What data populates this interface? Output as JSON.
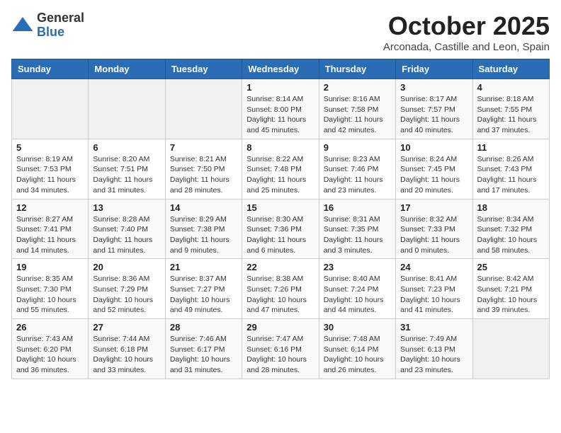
{
  "logo": {
    "general": "General",
    "blue": "Blue"
  },
  "header": {
    "month": "October 2025",
    "location": "Arconada, Castille and Leon, Spain"
  },
  "weekdays": [
    "Sunday",
    "Monday",
    "Tuesday",
    "Wednesday",
    "Thursday",
    "Friday",
    "Saturday"
  ],
  "weeks": [
    [
      {
        "day": "",
        "info": ""
      },
      {
        "day": "",
        "info": ""
      },
      {
        "day": "",
        "info": ""
      },
      {
        "day": "1",
        "info": "Sunrise: 8:14 AM\nSunset: 8:00 PM\nDaylight: 11 hours\nand 45 minutes."
      },
      {
        "day": "2",
        "info": "Sunrise: 8:16 AM\nSunset: 7:58 PM\nDaylight: 11 hours\nand 42 minutes."
      },
      {
        "day": "3",
        "info": "Sunrise: 8:17 AM\nSunset: 7:57 PM\nDaylight: 11 hours\nand 40 minutes."
      },
      {
        "day": "4",
        "info": "Sunrise: 8:18 AM\nSunset: 7:55 PM\nDaylight: 11 hours\nand 37 minutes."
      }
    ],
    [
      {
        "day": "5",
        "info": "Sunrise: 8:19 AM\nSunset: 7:53 PM\nDaylight: 11 hours\nand 34 minutes."
      },
      {
        "day": "6",
        "info": "Sunrise: 8:20 AM\nSunset: 7:51 PM\nDaylight: 11 hours\nand 31 minutes."
      },
      {
        "day": "7",
        "info": "Sunrise: 8:21 AM\nSunset: 7:50 PM\nDaylight: 11 hours\nand 28 minutes."
      },
      {
        "day": "8",
        "info": "Sunrise: 8:22 AM\nSunset: 7:48 PM\nDaylight: 11 hours\nand 25 minutes."
      },
      {
        "day": "9",
        "info": "Sunrise: 8:23 AM\nSunset: 7:46 PM\nDaylight: 11 hours\nand 23 minutes."
      },
      {
        "day": "10",
        "info": "Sunrise: 8:24 AM\nSunset: 7:45 PM\nDaylight: 11 hours\nand 20 minutes."
      },
      {
        "day": "11",
        "info": "Sunrise: 8:26 AM\nSunset: 7:43 PM\nDaylight: 11 hours\nand 17 minutes."
      }
    ],
    [
      {
        "day": "12",
        "info": "Sunrise: 8:27 AM\nSunset: 7:41 PM\nDaylight: 11 hours\nand 14 minutes."
      },
      {
        "day": "13",
        "info": "Sunrise: 8:28 AM\nSunset: 7:40 PM\nDaylight: 11 hours\nand 11 minutes."
      },
      {
        "day": "14",
        "info": "Sunrise: 8:29 AM\nSunset: 7:38 PM\nDaylight: 11 hours\nand 9 minutes."
      },
      {
        "day": "15",
        "info": "Sunrise: 8:30 AM\nSunset: 7:36 PM\nDaylight: 11 hours\nand 6 minutes."
      },
      {
        "day": "16",
        "info": "Sunrise: 8:31 AM\nSunset: 7:35 PM\nDaylight: 11 hours\nand 3 minutes."
      },
      {
        "day": "17",
        "info": "Sunrise: 8:32 AM\nSunset: 7:33 PM\nDaylight: 11 hours\nand 0 minutes."
      },
      {
        "day": "18",
        "info": "Sunrise: 8:34 AM\nSunset: 7:32 PM\nDaylight: 10 hours\nand 58 minutes."
      }
    ],
    [
      {
        "day": "19",
        "info": "Sunrise: 8:35 AM\nSunset: 7:30 PM\nDaylight: 10 hours\nand 55 minutes."
      },
      {
        "day": "20",
        "info": "Sunrise: 8:36 AM\nSunset: 7:29 PM\nDaylight: 10 hours\nand 52 minutes."
      },
      {
        "day": "21",
        "info": "Sunrise: 8:37 AM\nSunset: 7:27 PM\nDaylight: 10 hours\nand 49 minutes."
      },
      {
        "day": "22",
        "info": "Sunrise: 8:38 AM\nSunset: 7:26 PM\nDaylight: 10 hours\nand 47 minutes."
      },
      {
        "day": "23",
        "info": "Sunrise: 8:40 AM\nSunset: 7:24 PM\nDaylight: 10 hours\nand 44 minutes."
      },
      {
        "day": "24",
        "info": "Sunrise: 8:41 AM\nSunset: 7:23 PM\nDaylight: 10 hours\nand 41 minutes."
      },
      {
        "day": "25",
        "info": "Sunrise: 8:42 AM\nSunset: 7:21 PM\nDaylight: 10 hours\nand 39 minutes."
      }
    ],
    [
      {
        "day": "26",
        "info": "Sunrise: 7:43 AM\nSunset: 6:20 PM\nDaylight: 10 hours\nand 36 minutes."
      },
      {
        "day": "27",
        "info": "Sunrise: 7:44 AM\nSunset: 6:18 PM\nDaylight: 10 hours\nand 33 minutes."
      },
      {
        "day": "28",
        "info": "Sunrise: 7:46 AM\nSunset: 6:17 PM\nDaylight: 10 hours\nand 31 minutes."
      },
      {
        "day": "29",
        "info": "Sunrise: 7:47 AM\nSunset: 6:16 PM\nDaylight: 10 hours\nand 28 minutes."
      },
      {
        "day": "30",
        "info": "Sunrise: 7:48 AM\nSunset: 6:14 PM\nDaylight: 10 hours\nand 26 minutes."
      },
      {
        "day": "31",
        "info": "Sunrise: 7:49 AM\nSunset: 6:13 PM\nDaylight: 10 hours\nand 23 minutes."
      },
      {
        "day": "",
        "info": ""
      }
    ]
  ]
}
